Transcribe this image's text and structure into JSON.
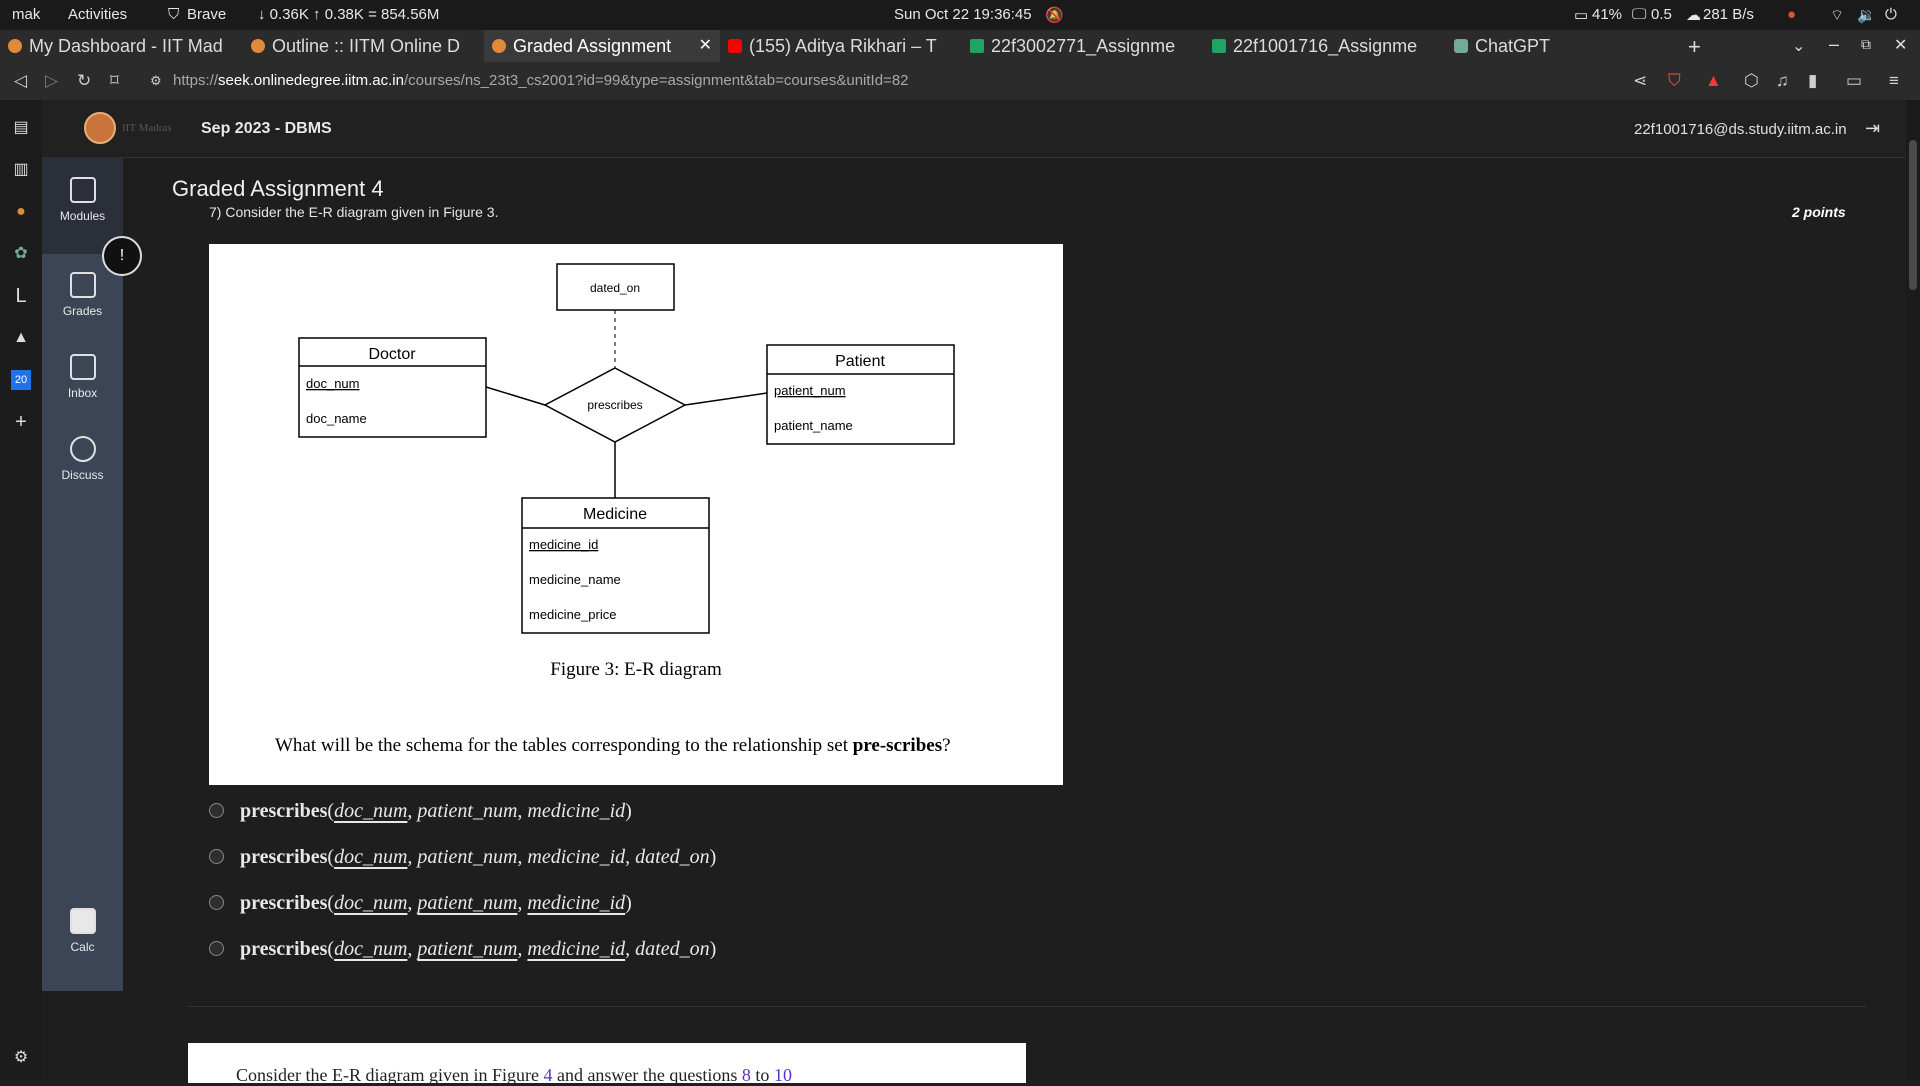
{
  "system_bar": {
    "user": "mak",
    "activities": "Activities",
    "browser": "Brave",
    "network": "↓ 0.36K ↑ 0.38K = 854.56M",
    "datetime": "Sun Oct 22  19:36:45",
    "battery": "41%",
    "load": "0.5",
    "rate": "281 B/s"
  },
  "tabs": [
    {
      "label": "My Dashboard - IIT Mad",
      "color": "#e08a3a"
    },
    {
      "label": "Outline :: IITM Online D",
      "color": "#e08a3a"
    },
    {
      "label": "Graded Assignment",
      "color": "#e08a3a",
      "active": true
    },
    {
      "label": "(155) Aditya Rikhari – T",
      "color": "#ff0000"
    },
    {
      "label": "22f3002771_Assignme",
      "color": "#1fa463"
    },
    {
      "label": "22f1001716_Assignme",
      "color": "#1fa463"
    },
    {
      "label": "ChatGPT",
      "color": "#74aa9c"
    }
  ],
  "address": {
    "prefix": "https://",
    "host": "seek.onlinedegree.iitm.ac.in",
    "path": "/courses/ns_23t3_cs2001?id=99&type=assignment&tab=courses&unitId=82"
  },
  "header": {
    "logo_text": "IIT Madras",
    "course": "Sep 2023 - DBMS",
    "email": "22f1001716@ds.study.iitm.ac.in"
  },
  "sidenav": [
    {
      "label": "Modules"
    },
    {
      "label": "Grades"
    },
    {
      "label": "Inbox"
    },
    {
      "label": "Discuss"
    },
    {
      "label": "Calc"
    }
  ],
  "main": {
    "title": "Graded Assignment 4",
    "question": "7) Consider the E-R diagram given in Figure 3.",
    "points": "2 points"
  },
  "diagram": {
    "attr_box": "dated_on",
    "relationship": "prescribes",
    "doctor": {
      "name": "Doctor",
      "attrs": [
        "doc_num",
        "doc_name"
      ]
    },
    "patient": {
      "name": "Patient",
      "attrs": [
        "patient_num",
        "patient_name"
      ]
    },
    "medicine": {
      "name": "Medicine",
      "attrs": [
        "medicine_id",
        "medicine_name",
        "medicine_price"
      ]
    },
    "caption": "Figure 3: E-R diagram",
    "prompt": "What will be the schema for the tables corresponding to the relationship set",
    "prompt_bold": "pre-scribes",
    "prompt_end": "?"
  },
  "options": [
    {
      "fn": "prescribes",
      "args": [
        "doc_num",
        "patient_num",
        "medicine_id"
      ],
      "underlined": [
        true,
        false,
        false
      ]
    },
    {
      "fn": "prescribes",
      "args": [
        "doc_num",
        "patient_num",
        "medicine_id",
        "dated_on"
      ],
      "underlined": [
        true,
        false,
        false,
        false
      ]
    },
    {
      "fn": "prescribes",
      "args": [
        "doc_num",
        "patient_num",
        "medicine_id"
      ],
      "underlined": [
        true,
        true,
        true
      ]
    },
    {
      "fn": "prescribes",
      "args": [
        "doc_num",
        "patient_num",
        "medicine_id",
        "dated_on"
      ],
      "underlined": [
        true,
        true,
        true,
        false
      ]
    }
  ],
  "next": {
    "text_a": "Consider the E-R diagram given in Figure",
    "fig": "4",
    "text_b": "and answer the questions",
    "q1": "8",
    "to": "to",
    "q2": "10"
  }
}
